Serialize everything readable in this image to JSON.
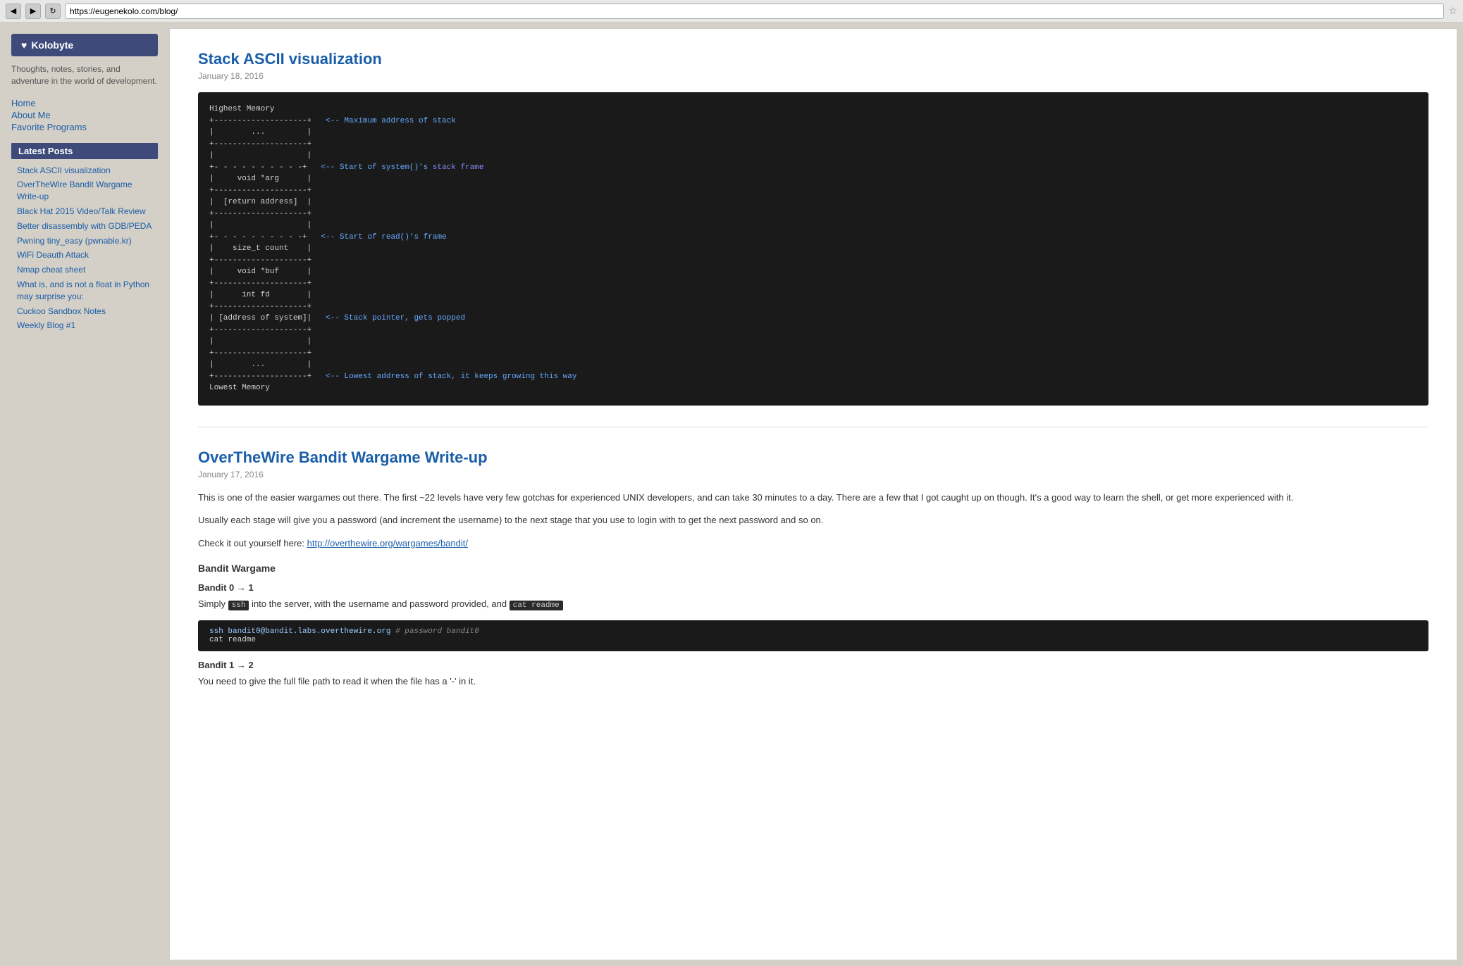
{
  "browser": {
    "url": "https://eugenekolo.com/blog/",
    "back_btn": "◀",
    "forward_btn": "▶",
    "refresh_btn": "↻"
  },
  "sidebar": {
    "logo_heart": "♥",
    "logo_text": "Kolobyte",
    "tagline": "Thoughts, notes, stories, and adventure in the world of development.",
    "nav": {
      "home": "Home",
      "about": "About Me",
      "favorite": "Favorite Programs"
    },
    "latest_posts_label": "Latest Posts",
    "posts": [
      "Stack ASCII visualization",
      "OverTheWire Bandit Wargame Write-up",
      "Black Hat 2015 Video/Talk Review",
      "Better disassembly with GDB/PEDA",
      "Pwning tiny_easy (pwnable.kr)",
      "WiFi Deauth Attack",
      "Nmap cheat sheet",
      "What is, and is not a float in Python may surprise you:",
      "Cuckoo Sandbox Notes",
      "Weekly Blog #1"
    ]
  },
  "main": {
    "post1": {
      "title": "Stack ASCII visualization",
      "date": "January 18, 2016",
      "code": "Highest Memory\n+--------------------+ <-- Maximum address of stack\n|        ...         |\n+--------------------+\n|                    |\n+- - - - - - - - - -+ <-- Start of system()'s stack frame\n|     void *arg      |\n+--------------------+\n|  [return address]  |\n+--------------------+\n|                    |\n+- - - - - - - - - -+ <-- Start of read()'s frame\n|    size_t count    |\n+--------------------+\n|     void *buf      |\n+--------------------+\n|      int fd        |\n+--------------------+\n| [address of system]| <-- Stack pointer, gets popped\n+--------------------+\n|                    |\n+--------------------+\n|        ...         |\n+--------------------+ <-- Lowest address of stack, it keeps growing this way\nLowest Memory"
    },
    "separator": true,
    "post2": {
      "title": "OverTheWire Bandit Wargame Write-up",
      "date": "January 17, 2016",
      "intro1": "This is one of the easier wargames out there. The first ~22 levels have very few gotchas for experienced UNIX developers, and can take 30 minutes to a day. There are a few that I got caught up on though. It's a good way to learn the shell, or get more experienced with it.",
      "intro2": "Usually each stage will give you a password (and increment the username) to the next stage that you use to login with to get the next password and so on.",
      "check_text_prefix": "Check it out yourself here: ",
      "check_link_text": "http://overthewire.org/wargames/bandit/",
      "check_link_url": "http://overthewire.org/wargames/bandit/",
      "section1_heading": "Bandit Wargame",
      "bandit01_heading": "Bandit 0 → 1",
      "bandit01_text_prefix": "Simply ",
      "bandit01_code1": "ssh",
      "bandit01_text_mid": " into the server, with the username and password provided, and ",
      "bandit01_code2": "cat readme",
      "bandit01_code_block": "ssh bandit0@bandit.labs.overthewire.org # password bandit0\ncat readme",
      "bandit12_heading": "Bandit 1 → 2",
      "bandit12_text": "You need to give the full file path to read it when the file has a '-' in it."
    }
  }
}
